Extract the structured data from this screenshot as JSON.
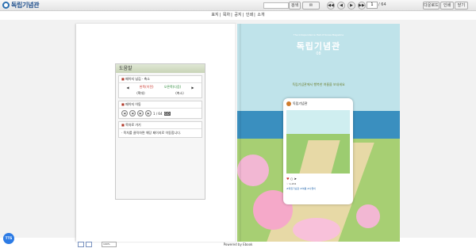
{
  "header": {
    "logo_text": "독립기념관",
    "search_button": "검색",
    "share_button": "",
    "page_current": "1",
    "page_total": "/ 64",
    "btn_download": "다운로드",
    "btn_print": "인쇄",
    "btn_close": "닫기",
    "nav_first": "◀◀",
    "nav_prev": "◀",
    "nav_next": "▶",
    "nav_last": "▶▶"
  },
  "menu": {
    "items": [
      "표지",
      "목차",
      "공지",
      "인쇄",
      "소개"
    ]
  },
  "help_panel": {
    "title": "도움말",
    "sections": [
      {
        "title": "페이지 넘김 · 축소",
        "line1_left": "왼쪽(이전)",
        "line1_right": "오른쪽(다음)",
        "line2_left": "(확대)",
        "line2_right": "(축소)"
      },
      {
        "title": "페이지 이동",
        "page_example": "1 / 64",
        "go_label": "GO"
      },
      {
        "title": "목차로 가기",
        "text": "· 목차를 클릭하면 해당 페이지로 이동합니다."
      }
    ]
  },
  "magazine": {
    "subtitle": "The Independence Hall of Korea Magazine",
    "title": "독립기념관",
    "issue": "08",
    "slogan": "독립기념관에서 행복한 여름을 보내세요",
    "card_name": "독립기념관",
    "card_likes": "♡ 1,234",
    "card_caption": "#독립기념관 #여름 #나들이"
  },
  "footer": {
    "zoom_value": "100%",
    "powered": "Powered by Ebook",
    "chat_label": "TTS"
  }
}
